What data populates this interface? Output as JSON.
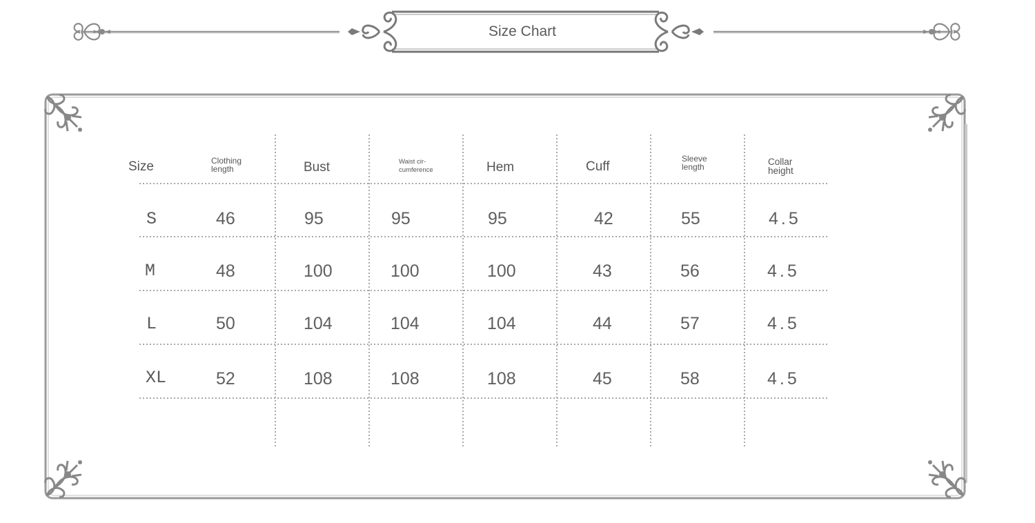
{
  "title": "Size Chart",
  "headers": {
    "size": "Size",
    "clothing_length": [
      "Clothing",
      "length"
    ],
    "bust": "Bust",
    "waist": [
      "Waist cir-",
      "cumference"
    ],
    "hem": "Hem",
    "cuff": "Cuff",
    "sleeve_length": [
      "Sleeve",
      "length"
    ],
    "collar_height": [
      "Collar",
      "height"
    ]
  },
  "rows": [
    {
      "size": "S",
      "values": [
        "46",
        "95",
        "95",
        "95",
        "42",
        "55",
        "4.5"
      ]
    },
    {
      "size": "M",
      "values": [
        "48",
        "100",
        "100",
        "100",
        "43",
        "56",
        "4.5"
      ]
    },
    {
      "size": "L",
      "values": [
        "50",
        "104",
        "104",
        "104",
        "44",
        "57",
        "4.5"
      ]
    },
    {
      "size": "XL",
      "values": [
        "52",
        "108",
        "108",
        "108",
        "45",
        "58",
        "4.5"
      ]
    }
  ],
  "colors": {
    "ornament": "#8a8a8a",
    "border": "#9a9a9a",
    "text": "#5f5f5f",
    "dots": "#b0b0b0"
  },
  "icons": [
    "fleur-ornament-icon",
    "scroll-swirl-icon",
    "corner-flourish-icon"
  ]
}
